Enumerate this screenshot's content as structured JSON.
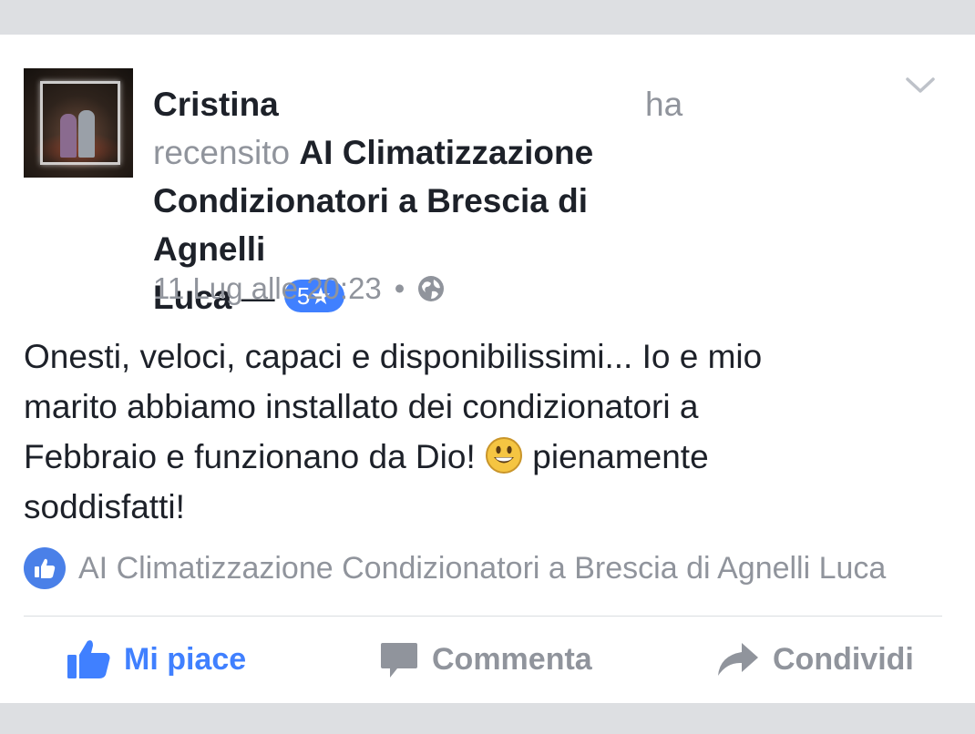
{
  "post": {
    "author": "Cristina",
    "verb_ha": "ha",
    "verb_recensito": "recensito",
    "page_name_line1": "AI Climatizzazione",
    "page_name_line2": "Condizionatori a Brescia di Agnelli",
    "page_name_line3": "Luca",
    "dash": "—",
    "rating": "5★",
    "timestamp": "11 Lug alle 20:23",
    "dot": "•",
    "body_line1": "Onesti, veloci, capaci e disponibilissimi... Io e mio",
    "body_line2": "marito abbiamo installato dei condizionatori a",
    "body_line3a": "Febbraio e funzionano da Dio!",
    "body_line3b": "pienamente",
    "body_line4": "soddisfatti!",
    "page_attribution": "AI Climatizzazione Condizionatori a Brescia di Agnelli Luca"
  },
  "actions": {
    "like": "Mi piace",
    "comment": "Commenta",
    "share": "Condividi"
  },
  "icons": {
    "globe": "globe-icon",
    "chevron": "chevron-down-icon",
    "emoji": "grinning-emoji-icon",
    "thumb": "thumbs-up-icon",
    "comment": "comment-icon",
    "share": "share-arrow-icon"
  },
  "colors": {
    "accent": "#4080ff",
    "muted": "#90949c",
    "text": "#1d2129",
    "background": "#dddfe2"
  }
}
